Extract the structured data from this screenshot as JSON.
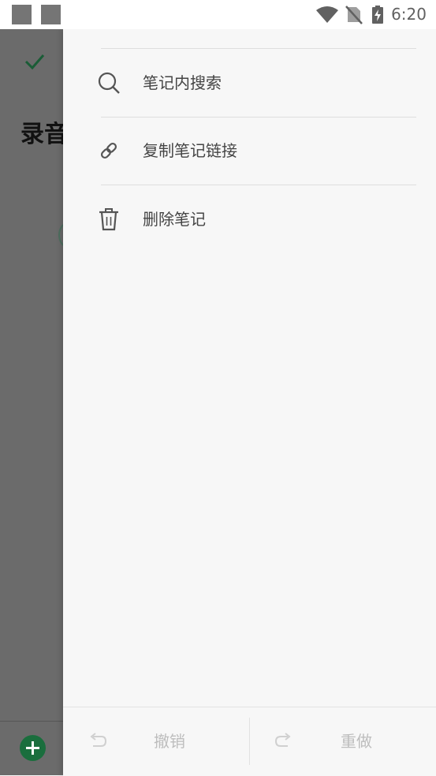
{
  "status_bar": {
    "time": "6:20",
    "icons": [
      "notification-square-icon",
      "notification-square-icon",
      "wifi-icon",
      "no-sim-icon",
      "battery-charging-icon"
    ]
  },
  "editor": {
    "title": "录音",
    "check_icon": "check-icon",
    "add_icon": "add-icon"
  },
  "drawer": {
    "items": [
      {
        "label": "笔记内搜索",
        "icon": "search-icon"
      },
      {
        "label": "复制笔记链接",
        "icon": "link-icon"
      },
      {
        "label": "删除笔记",
        "icon": "trash-icon"
      }
    ],
    "undo": {
      "label": "撤销",
      "icon": "undo-icon"
    },
    "redo": {
      "label": "重做",
      "icon": "redo-icon"
    }
  },
  "colors": {
    "accent": "#1a6e3d",
    "drawer_bg": "#f7f7f7",
    "scrim": "#6b6b6b",
    "label_text": "#444444",
    "disabled_text": "#bdbdbd"
  }
}
